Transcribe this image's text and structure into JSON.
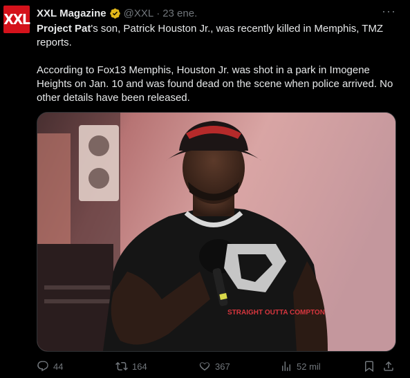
{
  "tweet": {
    "avatar_text": "XXL",
    "display_name": "XXL Magazine",
    "handle": "@XXL",
    "separator": "·",
    "date": "23 ene.",
    "more_label": "···",
    "body": {
      "p1_bold": "Project Pat",
      "p1_rest": "'s son, Patrick Houston Jr., was recently killed in Memphis, TMZ reports.",
      "p2": "According to Fox13 Memphis, Houston Jr. was shot in a park in Imogene Heights on Jan. 10 and was found dead on the scene when police arrived. No other details have been released."
    },
    "media": {
      "shirt_text": "STRAIGHT OUTTA COMPTON"
    },
    "actions": {
      "replies": "44",
      "reposts": "164",
      "likes": "367",
      "views": "52 mil"
    }
  },
  "colors": {
    "background": "#000000",
    "text": "#e7e9ea",
    "muted": "#71767b",
    "brand_red": "#d4121b",
    "verified_gold": "#e2b719"
  }
}
